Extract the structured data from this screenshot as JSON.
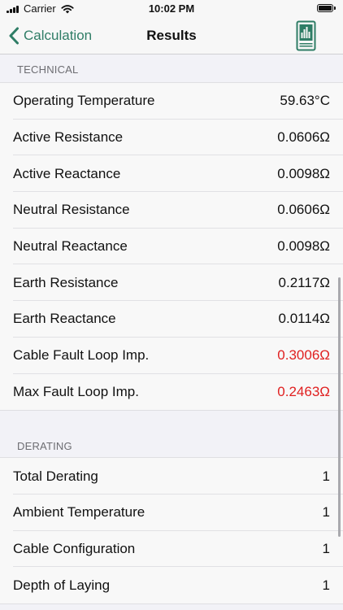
{
  "status_bar": {
    "carrier": "Carrier",
    "time": "10:02 PM"
  },
  "nav": {
    "back_label": "Calculation",
    "title": "Results",
    "back_icon": "chevron-left-icon",
    "report_icon": "report-document-icon",
    "accent_color": "#2f7d66"
  },
  "technical": {
    "header": "TECHNICAL",
    "rows": [
      {
        "label": "Operating Temperature",
        "value": "59.63°C"
      },
      {
        "label": "Active Resistance",
        "value": "0.0606Ω"
      },
      {
        "label": "Active Reactance",
        "value": "0.0098Ω"
      },
      {
        "label": "Neutral Resistance",
        "value": "0.0606Ω"
      },
      {
        "label": "Neutral Reactance",
        "value": "0.0098Ω"
      },
      {
        "label": "Earth Resistance",
        "value": "0.2117Ω"
      },
      {
        "label": "Earth Reactance",
        "value": "0.0114Ω"
      },
      {
        "label": "Cable Fault Loop Imp.",
        "value": "0.3006Ω"
      },
      {
        "label": "Max Fault Loop Imp.",
        "value": "0.2463Ω"
      }
    ]
  },
  "derating": {
    "header": "DERATING",
    "rows": [
      {
        "label": "Total Derating",
        "value": "1"
      },
      {
        "label": "Ambient Temperature",
        "value": "1"
      },
      {
        "label": "Cable Configuration",
        "value": "1"
      },
      {
        "label": "Depth of Laying",
        "value": "1"
      }
    ]
  },
  "alert_color": "#e02020"
}
